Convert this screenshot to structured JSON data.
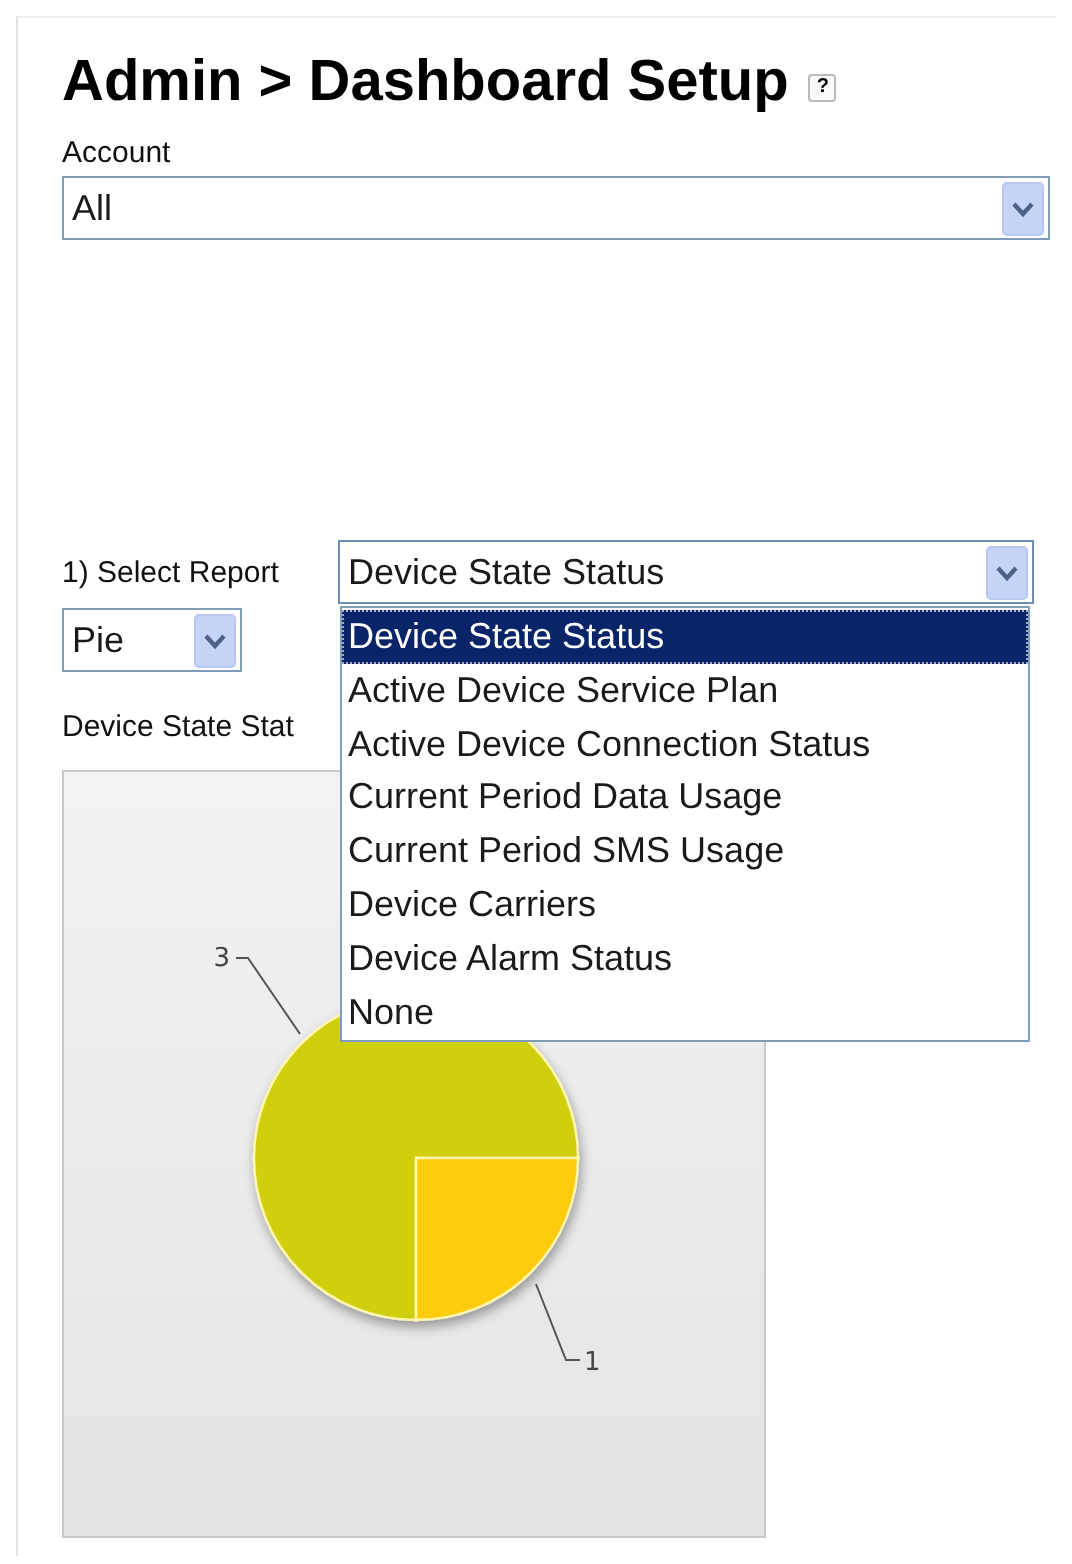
{
  "page": {
    "title": "Admin > Dashboard Setup",
    "help": "?"
  },
  "account": {
    "label": "Account",
    "value": "All"
  },
  "report": {
    "label": "1) Select Report",
    "value": "Device State Status",
    "expanded": true,
    "options": [
      {
        "label": "Device State Status",
        "selected": true
      },
      {
        "label": "Active Device Service Plan",
        "selected": false
      },
      {
        "label": "Active Device Connection Status",
        "selected": false
      },
      {
        "label": "Current Period Data Usage",
        "selected": false
      },
      {
        "label": "Current Period SMS Usage",
        "selected": false
      },
      {
        "label": "Device Carriers",
        "selected": false
      },
      {
        "label": "Device Alarm Status",
        "selected": false
      },
      {
        "label": "None",
        "selected": false
      }
    ]
  },
  "chart_type": {
    "value": "Pie"
  },
  "chart": {
    "title": "Device State Stat",
    "chart_data": {
      "type": "pie",
      "values": [
        3,
        1
      ],
      "data_labels": true
    }
  }
}
